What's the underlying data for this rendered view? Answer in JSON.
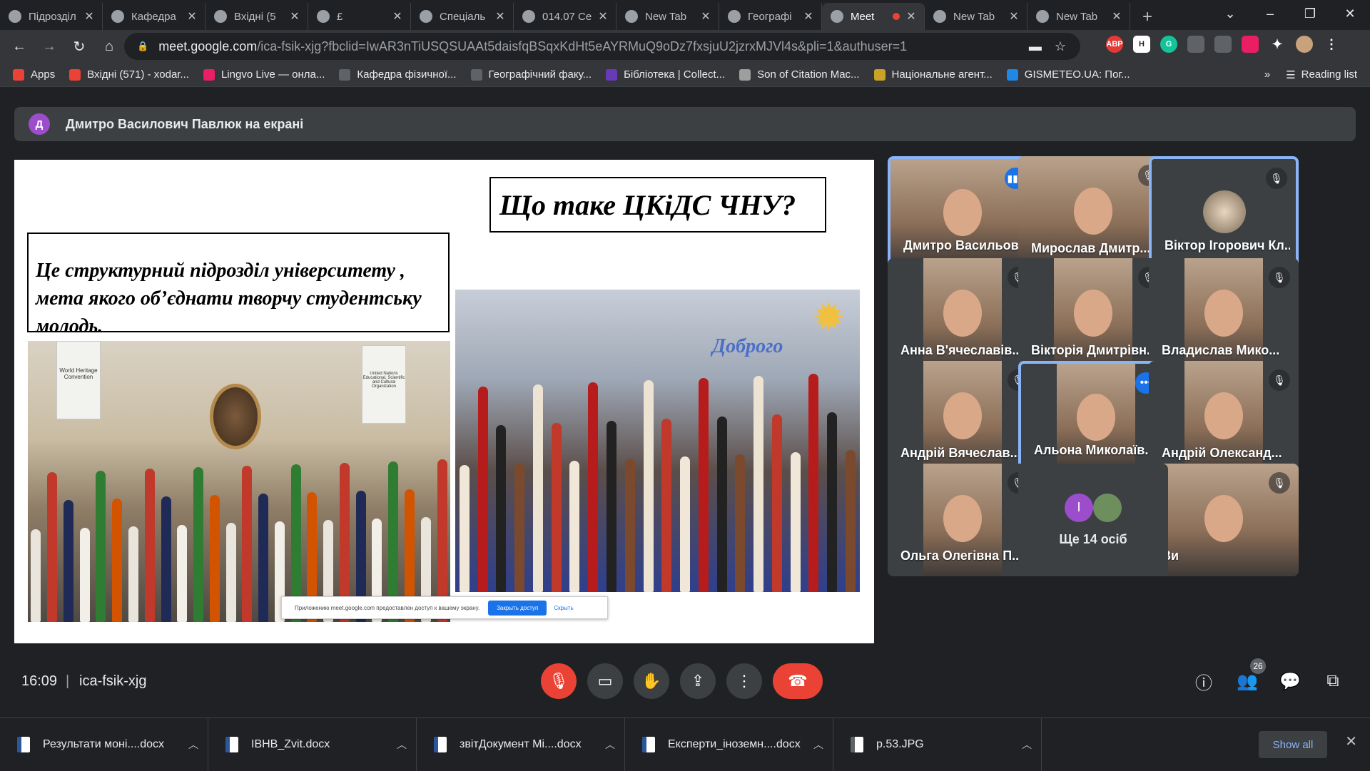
{
  "browser": {
    "tabs": [
      {
        "label": "Підрозділ",
        "icon": "globe-icon"
      },
      {
        "label": "Кафедра",
        "icon": "wordpress-icon"
      },
      {
        "label": "Вхідні (5",
        "icon": "gmail-icon"
      },
      {
        "label": "£",
        "icon": "globe-icon"
      },
      {
        "label": "Спеціаль",
        "icon": "globe-icon"
      },
      {
        "label": "014.07 Се",
        "icon": "globe-icon"
      },
      {
        "label": "New Tab",
        "icon": "chrome-icon"
      },
      {
        "label": "Географі",
        "icon": "globe-icon"
      },
      {
        "label": "Meet",
        "icon": "meet-icon",
        "active": true
      },
      {
        "label": "New Tab",
        "icon": "chrome-icon"
      },
      {
        "label": "New Tab",
        "icon": "chrome-icon"
      }
    ],
    "url_host": "meet.google.com",
    "url_path": "/ica-fsik-xjg?fbclid=IwAR3nTiUSQSUAAt5daisfqBSqxKdHt5eAYRMuQ9oDz7fxsjuU2jzrxMJVl4s&pli=1&authuser=1",
    "extensions": [
      "ABP",
      "H",
      "G"
    ],
    "bookmarks": [
      {
        "label": "Apps",
        "icon": "apps-grid-icon",
        "color": "#ea4335"
      },
      {
        "label": "Вхідні (571) - xodar...",
        "icon": "gmail-icon",
        "color": "#ea4335"
      },
      {
        "label": "Lingvo Live — онла...",
        "icon": "lingvo-icon",
        "color": "#e91e63"
      },
      {
        "label": "Кафедра фізичної...",
        "icon": "wordpress-icon",
        "color": "#5f6368"
      },
      {
        "label": "Географічний факу...",
        "icon": "globe-icon",
        "color": "#5f6368"
      },
      {
        "label": "Бібліотека | Collect...",
        "icon": "library-icon",
        "color": "#673ab7"
      },
      {
        "label": "Son of Citation Mac...",
        "icon": "citation-icon",
        "color": "#9e9e9e"
      },
      {
        "label": "Національне агент...",
        "icon": "trident-icon",
        "color": "#c9a227"
      },
      {
        "label": "GISMETEO.UA: Пог...",
        "icon": "drop-icon",
        "color": "#1e88e5"
      }
    ],
    "bookmarks_overflow": "»",
    "reading_list": "Reading list"
  },
  "meet": {
    "presenter_initial": "Д",
    "presenter_banner": "Дмитро Василович Павлюк на екрані",
    "slide": {
      "title": "Що таке ЦКіДС ЧНУ?",
      "body": "Це структурний підрозділ університету , мета якого об’єднати творчу студентську молодь.",
      "photo_banner_left": "World Heritage Convention",
      "photo_banner_right": "United Nations Educational, Scientific and Cultural Organization",
      "photo_sign": "Доброго",
      "share_notice": "Приложению meet.google.com предоставлен доступ к вашему экрану.",
      "share_stop": "Закрыть доступ",
      "share_hide": "Скрыть"
    },
    "participants": [
      {
        "name": "Дмитро Васильови...",
        "status": "speaking"
      },
      {
        "name": "Мирослав Дмитр...",
        "status": "muted"
      },
      {
        "name": "Віктор Ігорович Кл...",
        "status": "muted"
      },
      {
        "name": "Анна В'ячеславів...",
        "status": "muted"
      },
      {
        "name": "Вікторія Дмитрівн...",
        "status": "muted"
      },
      {
        "name": "Владислав Мико...",
        "status": "muted"
      },
      {
        "name": "Андрій Вячеслав...",
        "status": "muted"
      },
      {
        "name": "Альона Миколаїв...",
        "status": "more"
      },
      {
        "name": "Андрій Олександ...",
        "status": "muted"
      },
      {
        "name": "Ольга Олегівна П...",
        "status": "muted"
      },
      {
        "name": "Ви",
        "status": "muted"
      }
    ],
    "more_people": {
      "label": "Ще 14 осіб",
      "avatar_letter": "I"
    },
    "time": "16:09",
    "separator": "|",
    "meeting_code": "ica-fsik-xjg",
    "participants_count": "26"
  },
  "downloads": {
    "items": [
      "Результати моні....docx",
      "IBHB_Zvit.docx",
      "звітДокумент Mi....docx",
      "Експерти_іноземн....docx",
      "p.53.JPG"
    ],
    "show_all": "Show all"
  },
  "colors": {
    "accent": "#8ab4f8",
    "danger": "#ea4335",
    "meet_blue": "#1a73e8"
  }
}
